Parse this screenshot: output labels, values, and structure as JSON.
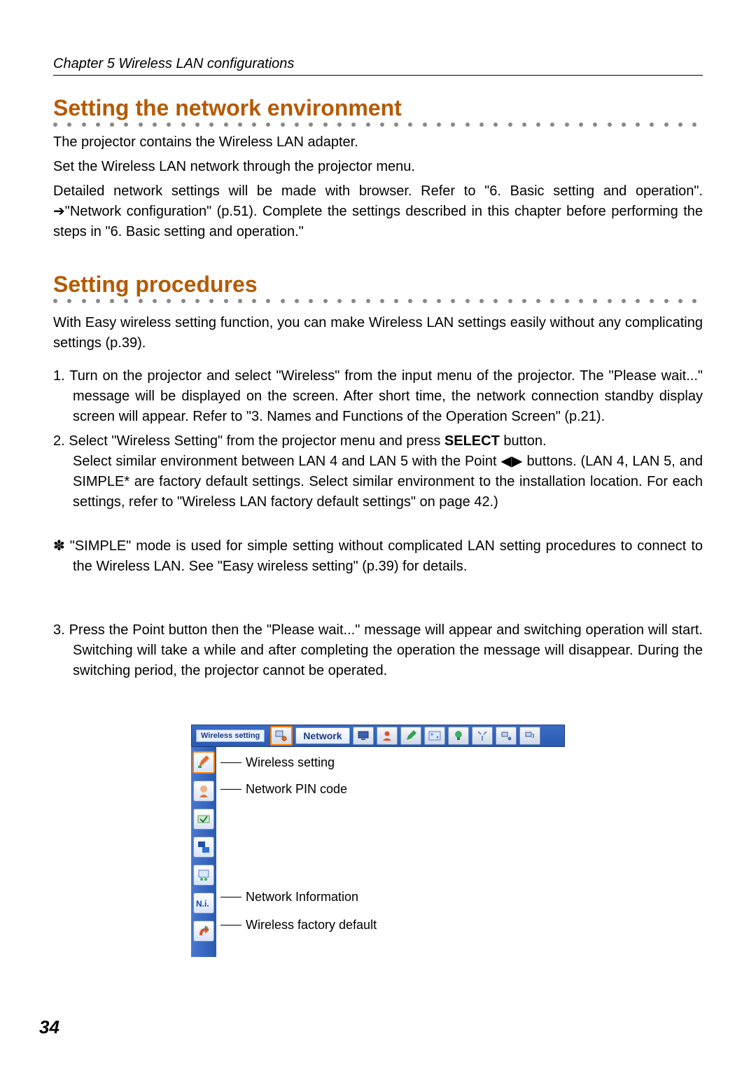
{
  "chapter_header": "Chapter 5 Wireless LAN configurations",
  "section1": {
    "title": "Setting the network environment",
    "p1": "The projector contains the Wireless LAN adapter.",
    "p2": "Set the Wireless LAN network through the projector menu.",
    "p3": "Detailed network settings will be made with browser.  Refer to \"6. Basic setting and operation\". ➔\"Network configuration\" (p.51).   Complete the settings described in this chapter before performing the steps in \"6. Basic setting and operation.\""
  },
  "section2": {
    "title": "Setting procedures",
    "intro": "With Easy wireless setting function, you can make Wireless LAN settings easily without any complicating settings  (p.39).",
    "item1": "1. Turn on the projector and select \"Wireless\" from the input menu of the projector. The \"Please wait...\" message will be displayed on the screen. After short time, the network connection standby display screen will appear.  Refer to \"3. Names and Functions of the Operation Screen\" (p.21).",
    "item2a": "2. Select \"Wireless Setting\" from the projector menu and press ",
    "item2_select": "SELECT",
    "item2b": " button.",
    "item2c": "Select similar environment between LAN 4 and LAN 5 with the Point ◀▶ buttons. (LAN 4, LAN 5, and SIMPLE* are factory default settings. Select similar environment to the installation location. For each settings, refer to \"Wireless LAN factory default settings\" on page 42.)",
    "note": "✽ \"SIMPLE\" mode is used for simple setting without complicated LAN setting procedures to connect to the Wireless LAN. See \"Easy wireless setting\" (p.39) for details.",
    "item3": "3. Press the Point button then the \"Please wait...\" message will appear and switching operation will start. Switching will take a while and after completing the operation the message will disappear. During the switching period, the projector cannot be operated."
  },
  "figure": {
    "menubar": {
      "wireless_setting_label": "Wireless setting",
      "network_label": "Network"
    },
    "callouts": {
      "wireless_setting": "Wireless setting",
      "network_pin": "Network PIN code",
      "network_info": "Network Information",
      "factory_default": "Wireless factory default"
    }
  },
  "page_number": "34"
}
